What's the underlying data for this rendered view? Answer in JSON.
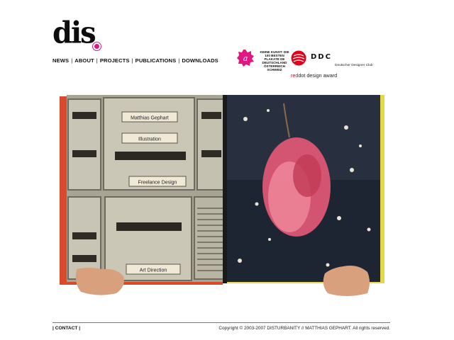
{
  "brand": {
    "logo_text": "dis",
    "accent_color": "#e2177f"
  },
  "nav": {
    "items": [
      {
        "label": "NEWS",
        "name": "nav-news"
      },
      {
        "label": "ABOUT",
        "name": "nav-about"
      },
      {
        "label": "PROJECTS",
        "name": "nav-projects"
      },
      {
        "label": "PUBLICATIONS",
        "name": "nav-publications"
      },
      {
        "label": "DOWNLOADS",
        "name": "nav-downloads"
      }
    ],
    "separator": "|"
  },
  "awards": {
    "kk_text": "KEINE KUNST: DIE 100 BESTEN PLAKATE DE DEUTSCHLAND ÖSTERREICH SCHWEIZ",
    "ddc_mark": "DDC",
    "ddc_text": "Deutscher Designer Club",
    "reddot_prefix": "red",
    "reddot_mid": "dot",
    "reddot_suffix": " design award"
  },
  "hero": {
    "mailbox_labels": [
      "Matthias Gephart",
      "Illustration",
      "Freelance Design",
      "Art Direction"
    ],
    "colors": {
      "metal": "#c9c5b6",
      "metal_dark": "#8f8b7c",
      "photo_dark": "#1e2532",
      "bouquet": "#e65a78",
      "hand": "#d9a07d"
    }
  },
  "footer": {
    "contact_label": "CONTACT",
    "separator": "|",
    "copyright": "Copyright © 2003-2007 DISTURBANITY // MATTHIAS GEPHART. All rights reserved."
  }
}
